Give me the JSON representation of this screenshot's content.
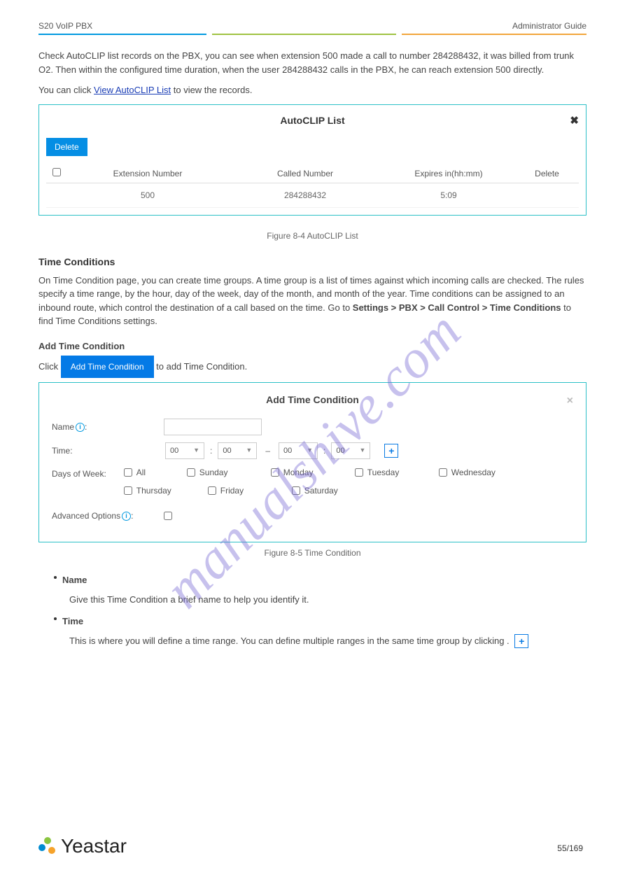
{
  "header": {
    "left": "S20 VoIP PBX",
    "right": "Administrator Guide"
  },
  "para1": "Check AutoCLIP list records on the PBX, you can see when extension 500 made a call to number 284288432, it was billed from trunk O2. Then within the configured time duration, when the user 284288432 calls in the PBX, he can reach extension 500 directly.",
  "para2_a": "You can click ",
  "para2_link": "View AutoCLIP List",
  "para2_b": " to view the records.",
  "autoclip": {
    "title": "AutoCLIP List",
    "delete_btn": "Delete",
    "cols": {
      "ext": "Extension Number",
      "called": "Called Number",
      "exp": "Expires in(hh:mm)",
      "del": "Delete"
    },
    "row": {
      "ext": "500",
      "called": "284288432",
      "exp": "5:09"
    }
  },
  "fig1": "Figure 8-4 AutoCLIP List",
  "sec_time": {
    "title": "Time Conditions",
    "intro": "On Time Condition page, you can create time groups. A time group is a list of times against which incoming calls are checked. The rules specify a time range, by the hour, day of the week, day of the month, and month of the year. Time conditions can be assigned to an inbound route, which control the destination of a call based on the time. Go to ",
    "path": "Settings > PBX > Call Control > Time Conditions",
    "outro": " to find Time Conditions settings."
  },
  "sub1": {
    "title": "Add Time Condition",
    "lead_a": "Click ",
    "btn": "Add Time Condition",
    "lead_b": " to add Time Condition."
  },
  "panel2": {
    "title": "Add Time Condition",
    "name_lbl": "Name",
    "time_lbl": "Time:",
    "dow_lbl": "Days of Week:",
    "adv_lbl": "Advanced Options",
    "sel": {
      "h1": "00",
      "m1": "00",
      "h2": "00",
      "m2": "00"
    },
    "days": {
      "all": "All",
      "sun": "Sunday",
      "mon": "Monday",
      "tue": "Tuesday",
      "wed": "Wednesday",
      "thu": "Thursday",
      "fri": "Friday",
      "sat": "Saturday"
    }
  },
  "fig2": "Figure 8-5 Time Condition",
  "bullets": {
    "name": {
      "lbl": "Name",
      "txt": "Give this Time Condition a brief name to help you identify it."
    },
    "time": {
      "lbl": "Time",
      "txt": "This is where you will define a time range. You can define multiple ranges in the same time group by clicking     ."
    }
  },
  "pagenum": "55/169",
  "logo": "Yeastar"
}
